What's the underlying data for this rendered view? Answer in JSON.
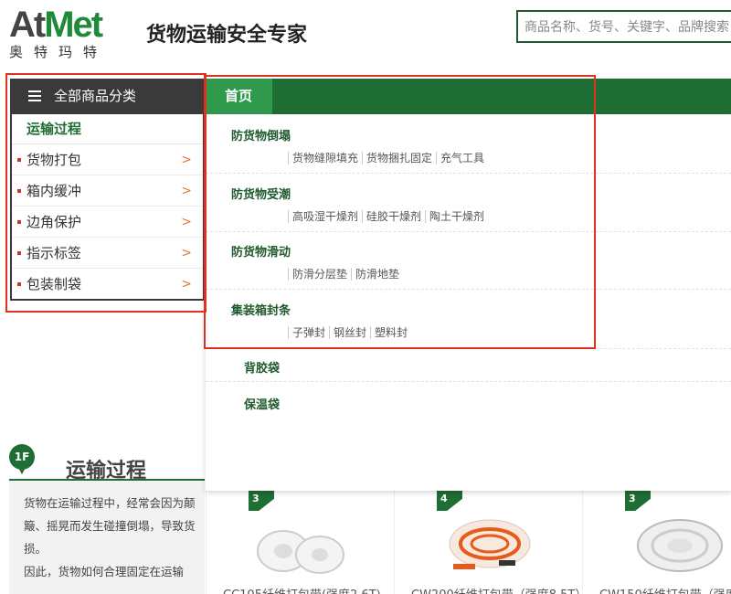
{
  "header": {
    "logo_mark_part1": "At",
    "logo_mark_part2": "Met",
    "logo_sub": "奥特玛特",
    "slogan": "货物运输安全专家",
    "search_placeholder": "商品名称、货号、关键字、品牌搜索"
  },
  "nav": {
    "home": "首页"
  },
  "category": {
    "header": "全部商品分类",
    "title": "运输过程",
    "items": [
      {
        "label": "货物打包"
      },
      {
        "label": "箱内缓冲"
      },
      {
        "label": "边角保护"
      },
      {
        "label": "指示标签"
      },
      {
        "label": "包装制袋"
      }
    ]
  },
  "dropdown": {
    "groups": [
      {
        "title": "防货物倒塌",
        "links": [
          "货物缝隙填充",
          "货物捆扎固定",
          "充气工具"
        ]
      },
      {
        "title": "防货物受潮",
        "links": [
          "高吸湿干燥剂",
          "硅胶干燥剂",
          "陶土干燥剂"
        ]
      },
      {
        "title": "防货物滑动",
        "links": [
          "防滑分层垫",
          "防滑地垫"
        ]
      },
      {
        "title": "集装箱封条",
        "links": [
          "子弹封",
          "钢丝封",
          "塑料封"
        ]
      }
    ],
    "extra": [
      "背胶袋",
      "保温袋"
    ]
  },
  "floor": {
    "badge": "1F",
    "title": "运输过程",
    "desc_p1": "货物在运输过程中，经常会因为颠簸、摇晃而发生碰撞倒塌，导致货损。",
    "desc_p2": "因此，货物如何合理固定在运输"
  },
  "products": [
    {
      "ribbon": "3",
      "name": "CC105纤维打包带(强度2.6T)"
    },
    {
      "ribbon": "4",
      "name": "CW200纤维打包带（强度8.5T）"
    },
    {
      "ribbon": "3",
      "name": "CW150纤维打包带（强度5"
    }
  ],
  "colors": {
    "brand_green": "#1f6e33",
    "accent_green": "#2f9a4c",
    "highlight_red": "#e0301e"
  }
}
